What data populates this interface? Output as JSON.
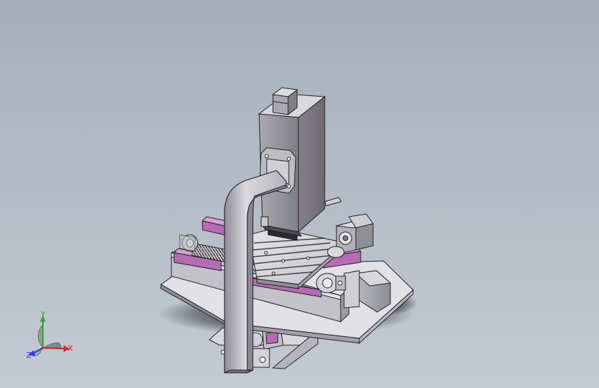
{
  "viewport": {
    "background_top": "#a5afbb",
    "background_bottom": "#c3cad2"
  },
  "colors": {
    "part_light": "#dcdce0",
    "part_mid": "#c6c6cc",
    "part_dark": "#9a9aa2",
    "edge": "#1e1e22",
    "rail_magenta": "#b66bb4",
    "shadow": "#2b3036"
  },
  "triad": {
    "x_label": "X",
    "y_label": "Y",
    "z_label": "Z",
    "x_color": "#d62828",
    "y_color": "#2fa62f",
    "z_color": "#2b3bd6"
  }
}
